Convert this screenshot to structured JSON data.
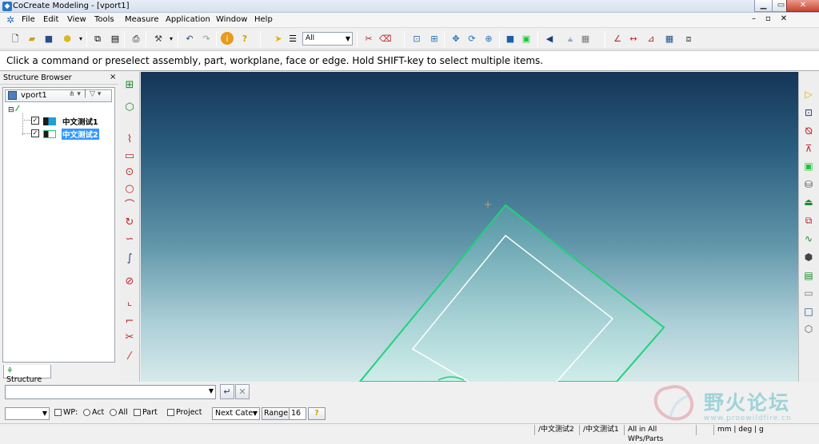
{
  "window": {
    "title": "CoCreate Modeling - [vport1]",
    "minimize": "▁",
    "maximize": "▭",
    "close": "✕"
  },
  "menu": {
    "items": [
      "File",
      "Edit",
      "View",
      "Tools",
      "Measure",
      "Application",
      "Window",
      "Help"
    ],
    "mdi": [
      "–",
      "▫",
      "✕"
    ]
  },
  "toolbar": {
    "filter_value": "All"
  },
  "prompt": {
    "text": "Click a command or preselect assembly, part, workplane, face or edge. Hold SHIFT-key to select multiple items."
  },
  "structure_browser": {
    "title": "Structure Browser",
    "close": "×",
    "combo_label": "vport1",
    "combo_controls": "⋔ ▾ │ ▽ ▾",
    "tree": [
      {
        "label": "中文测试1",
        "checked": true,
        "selected": false
      },
      {
        "label": "中文测试2",
        "checked": true,
        "selected": true
      }
    ],
    "tab_label": "Structure"
  },
  "command_row": {
    "ok_icon": "↵",
    "cancel_icon": "✕"
  },
  "options_row": {
    "wp_label": "WP:",
    "act_label": "Act",
    "all_label": "All",
    "part_label": "Part",
    "project_label": "Project",
    "next_cat_label": "Next Cate",
    "range_label": "Range:",
    "range_value": "16",
    "help_icon": "?"
  },
  "status_bar": {
    "items": [
      "/中文测试2",
      "/中文测试1",
      "All in All WPs/Parts",
      "",
      "mm | deg | g"
    ]
  },
  "watermark": {
    "text": "野火论坛",
    "url": "www.proewildfire.cn"
  },
  "colors": {
    "part_edge": "#1fd27a",
    "part_face": "#8fd3c6",
    "workplane_inner": "#ffffff"
  }
}
